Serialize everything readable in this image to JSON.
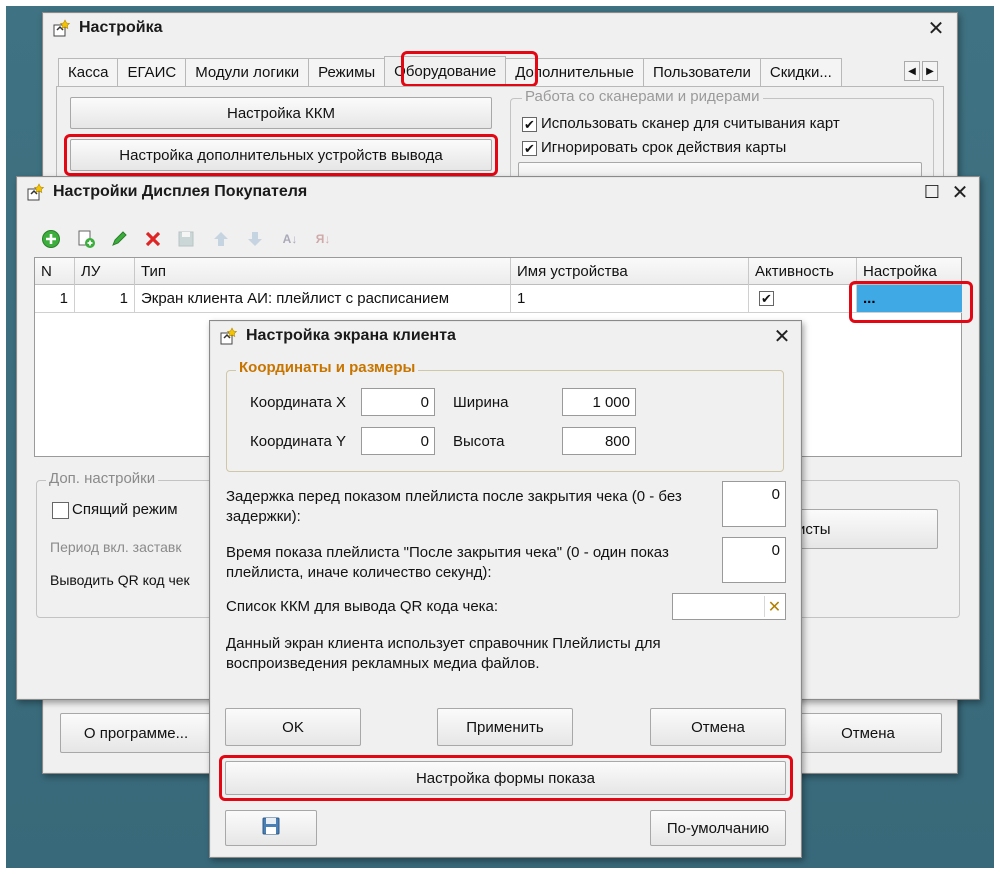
{
  "main_window": {
    "title": "Настройка",
    "tabs": [
      "Касса",
      "ЕГАИС",
      "Модули логики",
      "Режимы",
      "Оборудование",
      "Дополнительные",
      "Пользователи",
      "Скидки..."
    ],
    "active_tab": "Оборудование",
    "kkm_settings_button": "Настройка ККМ",
    "extra_devices_button": "Настройка дополнительных устройств вывода",
    "scanner_group_title": "Работа со сканерами и ридерами",
    "scanner_use_label": "Использовать сканер для считывания карт",
    "scanner_use_checked": true,
    "ignore_card_expiry_label": "Игнорировать срок действия карты",
    "ignore_card_expiry_checked": true,
    "about_button": "О программе...",
    "cancel_button": "Отмена"
  },
  "display_window": {
    "title": "Настройки Дисплея Покупателя",
    "columns": [
      "N",
      "ЛУ",
      "Тип",
      "Имя устройства",
      "Активность",
      "Настройка"
    ],
    "rows": [
      {
        "n": "1",
        "lu": "1",
        "type": "Экран клиента АИ: плейлист с расписанием",
        "device_name": "1",
        "active": true,
        "settings": "..."
      }
    ],
    "extra_group_title": "Доп. настройки",
    "sleep_mode_label": "Спящий режим",
    "screensaver_label": "Период вкл. заставк",
    "qr_label": "Выводить QR код чек",
    "playlists_button": "исты"
  },
  "client_dialog": {
    "title": "Настройка экрана клиента",
    "coords_group_title": "Координаты и размеры",
    "coord_x_label": "Координата X",
    "coord_x_value": "0",
    "coord_y_label": "Координата Y",
    "coord_y_value": "0",
    "width_label": "Ширина",
    "width_value": "1 000",
    "height_label": "Высота",
    "height_value": "800",
    "delay_label": "Задержка перед показом плейлиста после закрытия чека (0 - без задержки):",
    "delay_value": "0",
    "show_time_label": "Время показа плейлиста \"После закрытия чека\" (0 - один показ плейлиста, иначе количество секунд):",
    "show_time_value": "0",
    "kkm_list_label": "Список ККМ для вывода QR кода чека:",
    "info_text": "Данный экран клиента использует справочник Плейлисты для воспроизведения рекламных медиа файлов.",
    "ok_button": "OK",
    "apply_button": "Применить",
    "cancel_button": "Отмена",
    "form_settings_button": "Настройка формы показа",
    "default_button": "По-умолчанию"
  },
  "colors": {
    "highlight": "#e30613",
    "group_title_orange": "#c87500",
    "selection_blue": "#3fa9e6"
  }
}
